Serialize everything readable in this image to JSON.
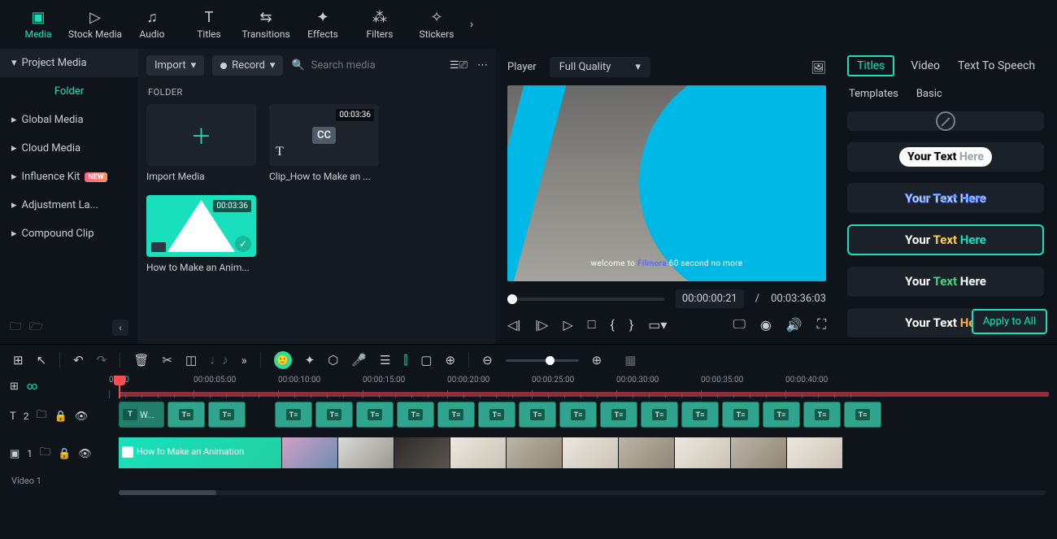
{
  "topTabs": [
    {
      "label": "Media",
      "icon": "▣"
    },
    {
      "label": "Stock Media",
      "icon": "▷"
    },
    {
      "label": "Audio",
      "icon": "♫"
    },
    {
      "label": "Titles",
      "icon": "T"
    },
    {
      "label": "Transitions",
      "icon": "⇆"
    },
    {
      "label": "Effects",
      "icon": "✦"
    },
    {
      "label": "Filters",
      "icon": "⁂"
    },
    {
      "label": "Stickers",
      "icon": "✧"
    }
  ],
  "sidebar": {
    "project": "Project Media",
    "folder": "Folder",
    "items": [
      "Global Media",
      "Cloud Media",
      "Influence Kit",
      "Adjustment La...",
      "Compound Clip"
    ],
    "newBadge": "NEW"
  },
  "mediaPanel": {
    "import": "Import",
    "record": "Record",
    "searchPlaceholder": "Search media",
    "folderLabel": "FOLDER",
    "importMedia": "Import Media",
    "clip1": {
      "name": "Clip_How to Make an ...",
      "duration": "00:03:36"
    },
    "clip2": {
      "name": "How to Make an Anim...",
      "duration": "00:03:36"
    }
  },
  "player": {
    "label": "Player",
    "quality": "Full Quality",
    "caption": {
      "a": "welcome to ",
      "b": "Filmora ",
      "c": "60 second no more"
    },
    "current": "00:00:00:21",
    "sep": "/",
    "total": "00:03:36:03"
  },
  "rightPanel": {
    "tabs": [
      "Titles",
      "Video",
      "Text To Speech"
    ],
    "subtabs": [
      "Templates",
      "Basic"
    ],
    "cards": {
      "yt": {
        "a": "Your Text ",
        "b": "Here"
      },
      "plain": "Your Text Here",
      "tri": {
        "a": "Your ",
        "b": "Text ",
        "c": "Here"
      },
      "green": {
        "a": "Your ",
        "b": "Text ",
        "c": "Here"
      },
      "orange": {
        "a": "Your Text ",
        "b": "Here"
      }
    },
    "apply": "Apply to All"
  },
  "ruler": [
    "00:00",
    "00:00:05:00",
    "00:00:10:00",
    "00:00:15:00",
    "00:00:20:00",
    "00:00:25:00",
    "00:00:30:00",
    "00:00:35:00",
    "00:00:40:00"
  ],
  "tracks": {
    "text": {
      "count": "2",
      "firstLabel": "W..."
    },
    "video": {
      "count": "1",
      "label": "Video 1"
    }
  }
}
